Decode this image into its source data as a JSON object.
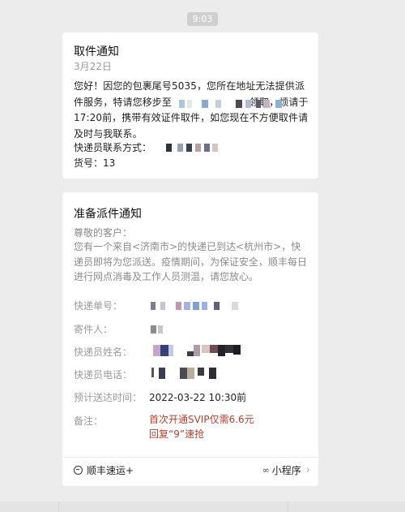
{
  "timestamp": "9:03",
  "card1": {
    "title": "取件通知",
    "date": "3月22日",
    "body_part1": "您好！因您的包裹尾号5035，您所在地址无法提供派件服务，特请您移步至",
    "body_part2": "领取，烦请于17:20前，携带有效证件取件，如您现在不方便取件请及时与我联系。",
    "courier_contact_label": "快递员联系方式：",
    "cargo_label": "货号：",
    "cargo_value": "13"
  },
  "card2": {
    "title": "准备派件通知",
    "greeting": "尊敬的客户：",
    "message": "您有一个来自<济南市>的快递已到达<杭州市>，快递员即将为您派送。疫情期间，为保证安全，顺丰每日进行网点消毒及工作人员测温，请您放心。",
    "rows": {
      "tracking_label": "快递单号：",
      "sender_label": "寄件人：",
      "courier_name_label": "快递员姓名：",
      "courier_phone_label": "快递员电话：",
      "eta_label": "预计送达时间：",
      "eta_value": "2022-03-22 10:30前",
      "note_label": "备注：",
      "note_line1": "首次开通SVIP仅需6.6元",
      "note_line2": "回复“9”速抢"
    },
    "footer": {
      "brand": "顺丰速运+",
      "mini_program": "小程序"
    }
  },
  "icons": {
    "brand": "sf-express-icon",
    "mini_program": "mini-program-icon",
    "chevron": "chevron-right-icon"
  }
}
